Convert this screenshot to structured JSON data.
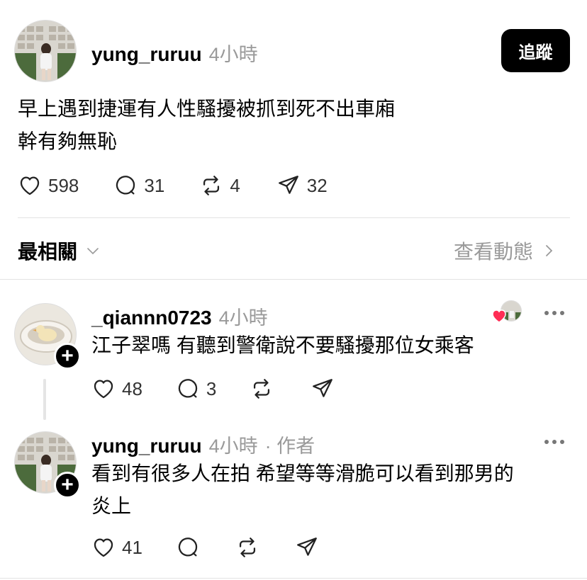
{
  "post": {
    "username": "yung_ruruu",
    "time": "4小時",
    "follow_label": "追蹤",
    "lines": [
      "早上遇到捷運有人性騷擾被抓到死不出車廂",
      "幹有夠無恥"
    ],
    "likes": "598",
    "comments": "31",
    "reposts": "4",
    "shares": "32"
  },
  "sort_bar": {
    "label": "最相關",
    "activity_link": "查看動態"
  },
  "replies": [
    {
      "username": "_qiannn0723",
      "time": "4小時",
      "text": "江子翠嗎 有聽到警衛說不要騷擾那位女乘客",
      "likes": "48",
      "comments": "3"
    },
    {
      "username": "yung_ruruu",
      "time": "4小時",
      "author_tag": "· 作者",
      "lines": [
        "看到有很多人在拍 希望等等滑脆可以看到那男的",
        "炎上"
      ],
      "likes": "41"
    }
  ],
  "icons": [
    "heart-icon",
    "comment-icon",
    "repost-icon",
    "send-icon",
    "chevron-down-icon",
    "chevron-right-icon",
    "more-icon",
    "plus-icon"
  ],
  "colors": {
    "accent": "#000000",
    "muted": "#9a9a9a",
    "heart": "#ff2d55"
  }
}
